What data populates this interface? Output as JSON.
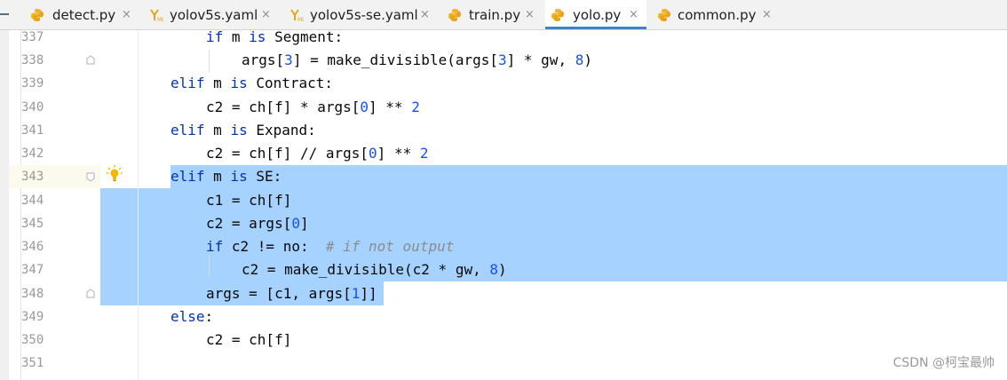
{
  "tabs": [
    {
      "label": "detect.py",
      "icon": "python-file-icon"
    },
    {
      "label": "yolov5s.yaml",
      "icon": "yaml-file-icon"
    },
    {
      "label": "yolov5s-se.yaml",
      "icon": "yaml-file-icon"
    },
    {
      "label": "train.py",
      "icon": "python-file-icon"
    },
    {
      "label": "yolo.py",
      "icon": "python-file-icon",
      "active": true
    },
    {
      "label": "common.py",
      "icon": "python-file-icon"
    }
  ],
  "tab_close_glyph": "×",
  "line_numbers": [
    "337",
    "338",
    "339",
    "340",
    "341",
    "342",
    "343",
    "344",
    "345",
    "346",
    "347",
    "348",
    "349",
    "350",
    "351"
  ],
  "code": {
    "l337": {
      "a": "if",
      "b": " m ",
      "c": "is",
      "d": " Segment:"
    },
    "l338": {
      "a": "args[",
      "b": "3",
      "c": "] = make_divisible(args[",
      "d": "3",
      "e": "] * gw, ",
      "f": "8",
      "g": ")"
    },
    "l339": {
      "a": "elif",
      "b": " m ",
      "c": "is",
      "d": " Contract:"
    },
    "l340": {
      "a": "c2 = ch[f] * args[",
      "b": "0",
      "c": "] ** ",
      "d": "2"
    },
    "l341": {
      "a": "elif",
      "b": " m ",
      "c": "is",
      "d": " Expand:"
    },
    "l342": {
      "a": "c2 = ch[f] // args[",
      "b": "0",
      "c": "] ** ",
      "d": "2"
    },
    "l343": {
      "a": "elif",
      "b": " m ",
      "c": "is",
      "d": " SE:"
    },
    "l344": {
      "a": "c1 = ch[f]"
    },
    "l345": {
      "a": "c2 = args[",
      "b": "0",
      "c": "]"
    },
    "l346": {
      "a": "if",
      "b": " c2 != no:  ",
      "c": "# if not output"
    },
    "l347": {
      "a": "c2 = make_divisible(c2 * gw, ",
      "b": "8",
      "c": ")"
    },
    "l348": {
      "a": "args = [c1, args[",
      "b": "1",
      "c": "]]"
    },
    "l349": {
      "a": "else",
      "b": ":"
    },
    "l350": {
      "a": "c2 = ch[f]"
    }
  },
  "watermark": "CSDN @柯宝最帅",
  "colors": {
    "keyword": "#0033b3",
    "number": "#1750eb",
    "comment": "#8c8c8c",
    "selection": "#a6d2ff",
    "active_tab_underline": "#4083c9"
  }
}
